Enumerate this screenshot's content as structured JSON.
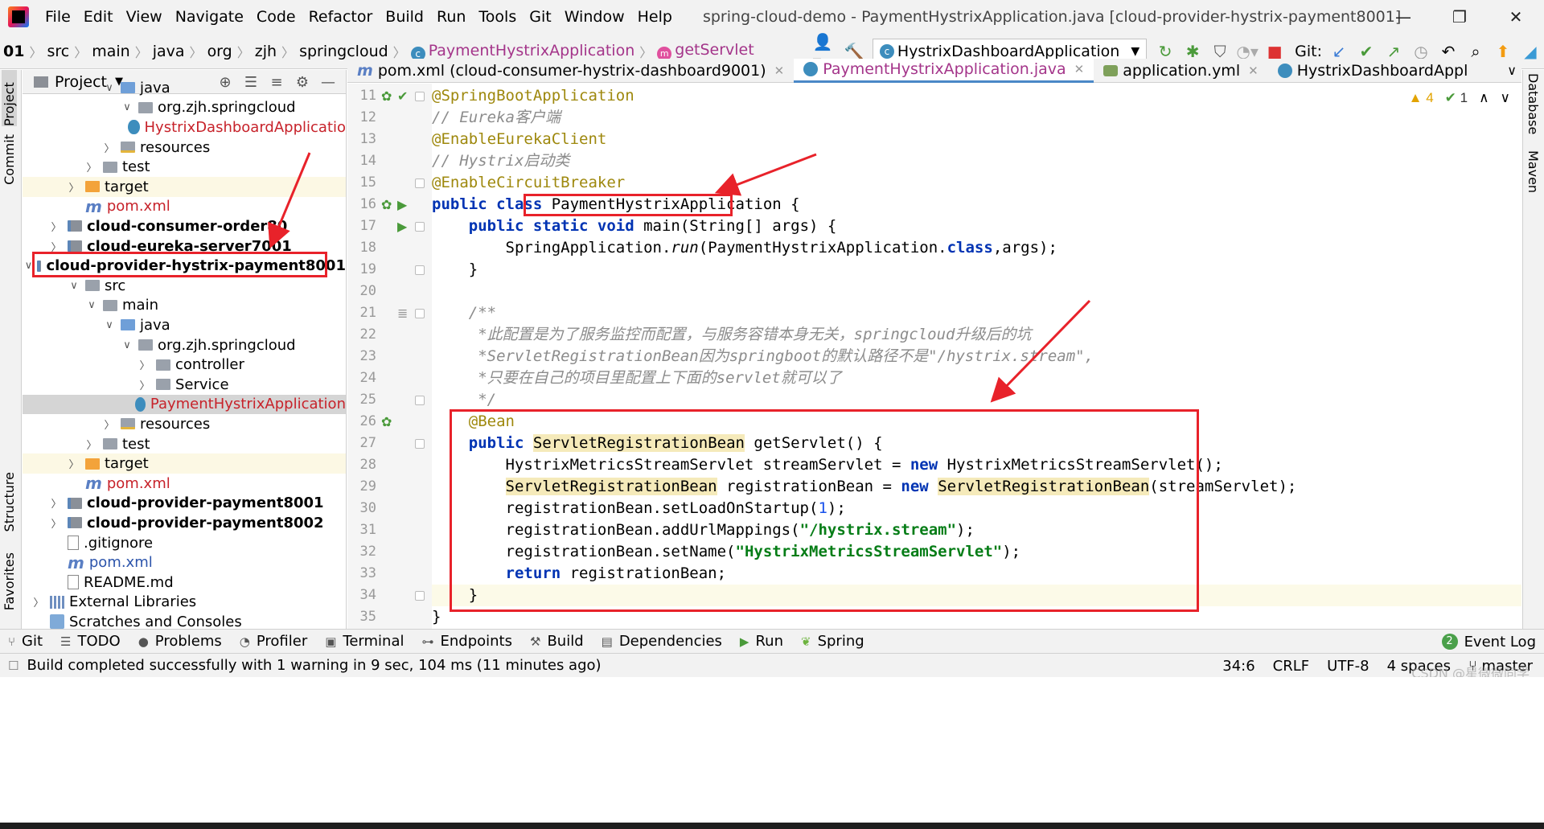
{
  "menu": [
    "File",
    "Edit",
    "View",
    "Navigate",
    "Code",
    "Refactor",
    "Build",
    "Run",
    "Tools",
    "Git",
    "Window",
    "Help"
  ],
  "window_title": "spring-cloud-demo - PaymentHystrixApplication.java [cloud-provider-hystrix-payment8001]",
  "breadcrumb": [
    "01",
    "src",
    "main",
    "java",
    "org",
    "zjh",
    "springcloud",
    "PaymentHystrixApplication",
    "getServlet"
  ],
  "run_config": "HystrixDashboardApplication",
  "git_label": "Git:",
  "panel_title": "Project",
  "tree": [
    {
      "label": "java",
      "depth": 5,
      "icon": "blue",
      "chev": "v"
    },
    {
      "label": "org.zjh.springcloud",
      "depth": 6,
      "icon": "grey",
      "chev": "v"
    },
    {
      "label": "HystrixDashboardApplicatio",
      "depth": 7,
      "icon": "class",
      "style": "red"
    },
    {
      "label": "resources",
      "depth": 5,
      "icon": "res",
      "chev": ">"
    },
    {
      "label": "test",
      "depth": 4,
      "icon": "grey",
      "chev": ">"
    },
    {
      "label": "target",
      "depth": 3,
      "icon": "orange",
      "chev": ">",
      "excluded": true
    },
    {
      "label": "pom.xml",
      "depth": 3,
      "icon": "m",
      "style": "red"
    },
    {
      "label": "cloud-consumer-order80",
      "depth": 2,
      "icon": "mod",
      "chev": ">",
      "style": "bold"
    },
    {
      "label": "cloud-eureka-server7001",
      "depth": 2,
      "icon": "mod",
      "chev": ">",
      "style": "bold"
    },
    {
      "label": "cloud-provider-hystrix-payment8001",
      "depth": 2,
      "icon": "mod",
      "chev": "v",
      "style": "bold"
    },
    {
      "label": "src",
      "depth": 3,
      "icon": "grey",
      "chev": "v"
    },
    {
      "label": "main",
      "depth": 4,
      "icon": "grey",
      "chev": "v"
    },
    {
      "label": "java",
      "depth": 5,
      "icon": "blue",
      "chev": "v"
    },
    {
      "label": "org.zjh.springcloud",
      "depth": 6,
      "icon": "grey",
      "chev": "v"
    },
    {
      "label": "controller",
      "depth": 7,
      "icon": "grey",
      "chev": ">"
    },
    {
      "label": "Service",
      "depth": 7,
      "icon": "grey",
      "chev": ">"
    },
    {
      "label": "PaymentHystrixApplication",
      "depth": 8,
      "icon": "class",
      "style": "red",
      "selected": true
    },
    {
      "label": "resources",
      "depth": 5,
      "icon": "res",
      "chev": ">"
    },
    {
      "label": "test",
      "depth": 4,
      "icon": "grey",
      "chev": ">"
    },
    {
      "label": "target",
      "depth": 3,
      "icon": "orange",
      "chev": ">",
      "excluded": true
    },
    {
      "label": "pom.xml",
      "depth": 3,
      "icon": "m",
      "style": "red"
    },
    {
      "label": "cloud-provider-payment8001",
      "depth": 2,
      "icon": "mod",
      "chev": ">",
      "style": "bold"
    },
    {
      "label": "cloud-provider-payment8002",
      "depth": 2,
      "icon": "mod",
      "chev": ">",
      "style": "bold"
    },
    {
      "label": ".gitignore",
      "depth": 2,
      "icon": "txt"
    },
    {
      "label": "pom.xml",
      "depth": 2,
      "icon": "m",
      "style": "blue"
    },
    {
      "label": "README.md",
      "depth": 2,
      "icon": "txt"
    },
    {
      "label": "External Libraries",
      "depth": 1,
      "icon": "lib",
      "chev": ">"
    },
    {
      "label": "Scratches and Consoles",
      "depth": 1,
      "icon": "scr"
    }
  ],
  "tabs": [
    {
      "label": "pom.xml (cloud-consumer-hystrix-dashboard9001)",
      "icon": "m"
    },
    {
      "label": "PaymentHystrixApplication.java",
      "icon": "c",
      "active": true
    },
    {
      "label": "application.yml",
      "icon": "y"
    },
    {
      "label": "HystrixDashboardAppl",
      "icon": "c"
    }
  ],
  "inspection": {
    "warnings": "4",
    "ok": "1"
  },
  "code_lines": [
    {
      "n": "11",
      "html": "<span class=\"an\">@SpringBootApplication</span>"
    },
    {
      "n": "12",
      "html": "<span class=\"cm\">// Eureka客户端</span>"
    },
    {
      "n": "13",
      "html": "<span class=\"an\">@EnableEurekaClient</span>"
    },
    {
      "n": "14",
      "html": "<span class=\"cm\">// Hystrix启动类</span>"
    },
    {
      "n": "15",
      "html": "<span class=\"an\">@EnableCircuitBreaker</span>"
    },
    {
      "n": "16",
      "html": "<span class=\"kw\">public class</span> PaymentHystrixApplication {"
    },
    {
      "n": "17",
      "html": "    <span class=\"kw\">public static void</span> main(String[] args) {"
    },
    {
      "n": "18",
      "html": "        SpringApplication.<span class=\"it\">run</span>(PaymentHystrixApplication.<span class=\"kw\">class</span>,args);"
    },
    {
      "n": "19",
      "html": "    }"
    },
    {
      "n": "20",
      "html": ""
    },
    {
      "n": "21",
      "html": "    <span class=\"cm\">/**</span>"
    },
    {
      "n": "22",
      "html": "     <span class=\"cm\">*此配置是为了服务监控而配置，与服务容错本身无关，springcloud升级后的坑</span>"
    },
    {
      "n": "23",
      "html": "     <span class=\"cm\">*ServletRegistrationBean因为springboot的默认路径不是\"/hystrix.stream\",</span>"
    },
    {
      "n": "24",
      "html": "     <span class=\"cm\">*只要在自己的项目里配置上下面的servlet就可以了</span>"
    },
    {
      "n": "25",
      "html": "     <span class=\"cm\">*/</span>"
    },
    {
      "n": "26",
      "html": "    <span class=\"an\">@Bean</span>"
    },
    {
      "n": "27",
      "html": "    <span class=\"kw\">public</span> <span class=\"hl\">ServletRegistrationBean</span> getServlet() {"
    },
    {
      "n": "28",
      "html": "        HystrixMetricsStreamServlet streamServlet = <span class=\"kw\">new</span> HystrixMetricsStreamServlet();"
    },
    {
      "n": "29",
      "html": "        <span class=\"hl\">ServletRegistrationBean</span> registrationBean = <span class=\"kw\">new</span> <span class=\"hl\">ServletRegistrationBean</span>(streamServlet);"
    },
    {
      "n": "30",
      "html": "        registrationBean.setLoadOnStartup(<span class=\"num\">1</span>);"
    },
    {
      "n": "31",
      "html": "        registrationBean.addUrlMappings(<span class=\"st\">\"/hystrix.stream\"</span>);"
    },
    {
      "n": "32",
      "html": "        registrationBean.setName(<span class=\"st\">\"HystrixMetricsStreamServlet\"</span>);"
    },
    {
      "n": "33",
      "html": "        <span class=\"kw\">return</span> registrationBean;"
    },
    {
      "n": "34",
      "html": "    }"
    },
    {
      "n": "35",
      "html": "}"
    }
  ],
  "bottom_tools": [
    "Git",
    "TODO",
    "Problems",
    "Profiler",
    "Terminal",
    "Endpoints",
    "Build",
    "Dependencies",
    "Run",
    "Spring"
  ],
  "event_log": "Event Log",
  "event_count": "2",
  "status": {
    "message": "Build completed successfully with 1 warning in 9 sec, 104 ms (11 minutes ago)",
    "position": "34:6",
    "line_sep": "CRLF",
    "encoding": "UTF-8",
    "indent": "4 spaces",
    "branch": "master"
  },
  "side_tabs": {
    "left": [
      "Project",
      "Commit",
      "Structure",
      "Favorites"
    ],
    "right": [
      "Database",
      "Maven"
    ]
  },
  "watermark": "CSDN @星微微同学"
}
